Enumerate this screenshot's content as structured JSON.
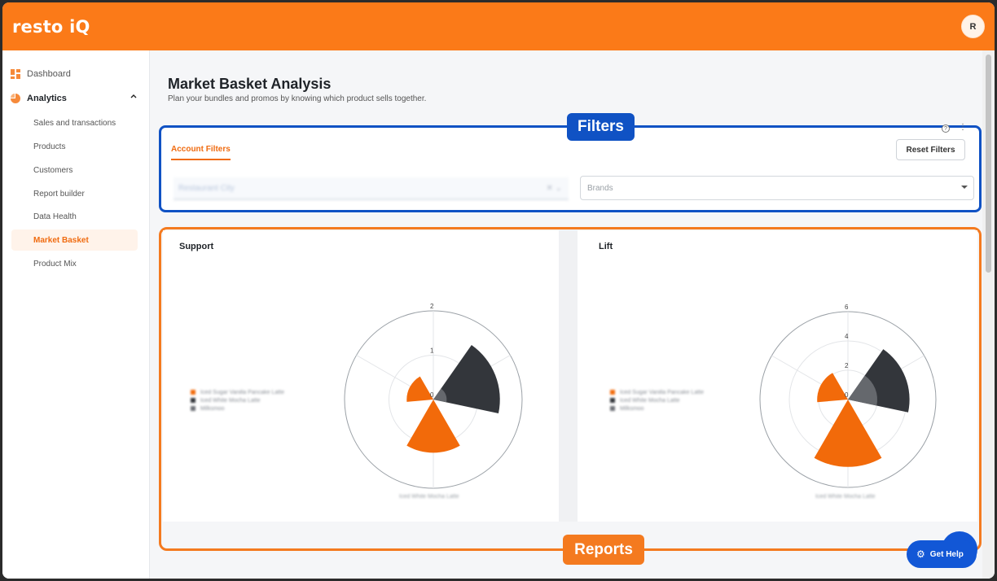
{
  "app": {
    "logo": "resto iQ",
    "avatar_initial": "R"
  },
  "sidebar": {
    "dashboard": "Dashboard",
    "analytics": "Analytics",
    "items": [
      {
        "label": "Sales and transactions"
      },
      {
        "label": "Products"
      },
      {
        "label": "Customers"
      },
      {
        "label": "Report builder"
      },
      {
        "label": "Data Health"
      },
      {
        "label": "Market Basket",
        "active": true
      },
      {
        "label": "Product Mix"
      }
    ]
  },
  "page": {
    "title": "Market Basket Analysis",
    "subtitle": "Plan your bundles and promos by knowing which product sells together."
  },
  "annotations": {
    "filters": "Filters",
    "reports": "Reports"
  },
  "filters": {
    "tab": "Account Filters",
    "reset_label": "Reset Filters",
    "location_value": "Restaurant City",
    "brands_placeholder": "Brands",
    "help_icon": "?",
    "more_icon": "⋮"
  },
  "help": {
    "label": "Get Help"
  },
  "colors": {
    "accent": "#fb7a18",
    "filters_frame": "#1052c4",
    "dark_sector": "#33363b",
    "orange_sector": "#f26a0a"
  },
  "chart_data": [
    {
      "type": "polar-bar",
      "title": "Support",
      "radial_ticks": [
        0,
        1,
        2
      ],
      "rmax": 2,
      "series": [
        {
          "name": "Iced Sugar Vanilla Pancake Latte",
          "color": "#f26a0a",
          "value": 0.6,
          "direction": "upper-left"
        },
        {
          "name": "Iced White Mocha Latte",
          "color": "#33363b",
          "value": 1.5,
          "direction": "right"
        },
        {
          "name": "Milksmoo",
          "color": "#6e7177",
          "value": 0.3,
          "direction": "right"
        },
        {
          "name": "Iced White Mocha Latte",
          "color": "#f26a0a",
          "value": 1.2,
          "direction": "down"
        }
      ],
      "legend": [
        "Iced Sugar Vanilla Pancake Latte",
        "Iced White Mocha Latte",
        "Milksmoo"
      ],
      "bottom_label": "Iced White Mocha Latte"
    },
    {
      "type": "polar-bar",
      "title": "Lift",
      "radial_ticks": [
        0,
        2,
        4,
        6
      ],
      "rmax": 6,
      "series": [
        {
          "name": "Iced Sugar Vanilla Pancake Latte",
          "color": "#f26a0a",
          "value": 2.1,
          "direction": "upper-left"
        },
        {
          "name": "Iced White Mocha Latte",
          "color": "#33363b",
          "value": 4.2,
          "direction": "right"
        },
        {
          "name": "Milksmoo",
          "color": "#6e7177",
          "value": 2.0,
          "direction": "right"
        },
        {
          "name": "Iced White Mocha Latte",
          "color": "#f26a0a",
          "value": 4.6,
          "direction": "down"
        }
      ],
      "legend": [
        "Iced Sugar Vanilla Pancake Latte",
        "Iced White Mocha Latte",
        "Milksmoo"
      ],
      "bottom_label": "Iced White Mocha Latte"
    }
  ]
}
